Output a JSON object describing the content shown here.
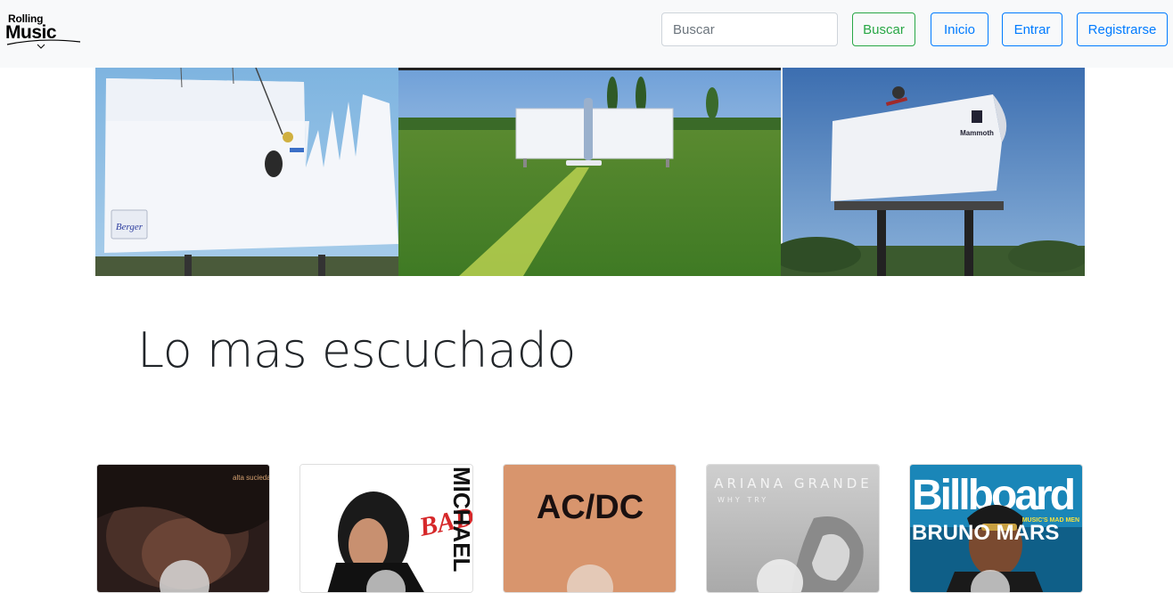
{
  "navbar": {
    "brand_top": "Rolling",
    "brand_main": "Music",
    "search_placeholder": "Buscar",
    "search_button": "Buscar",
    "home_button": "Inicio",
    "login_button": "Entrar",
    "register_button": "Registrarse"
  },
  "hero": {
    "panels": [
      {
        "name": "billboard-painter",
        "logo_text": "Berger"
      },
      {
        "name": "billboard-field-mower"
      },
      {
        "name": "billboard-skateboard",
        "logo_text": "Mammoth"
      }
    ]
  },
  "main": {
    "section_title": "Lo mas escuchado",
    "albums": [
      {
        "cover_text": "alta suciedad"
      },
      {
        "cover_text": "BAD",
        "side_text": "MICHAEL"
      },
      {
        "cover_text": "AC/DC"
      },
      {
        "cover_text": "ARIANA GRANDE",
        "subtitle": "WHY TRY"
      },
      {
        "cover_text": "Billboard",
        "name_text": "BRUNO MARS",
        "side_text": "MUSIC'S MAD MEN"
      }
    ]
  },
  "colors": {
    "navbar_bg": "#f8f9fa",
    "success": "#28a745",
    "primary": "#007bff",
    "title": "#212529"
  }
}
